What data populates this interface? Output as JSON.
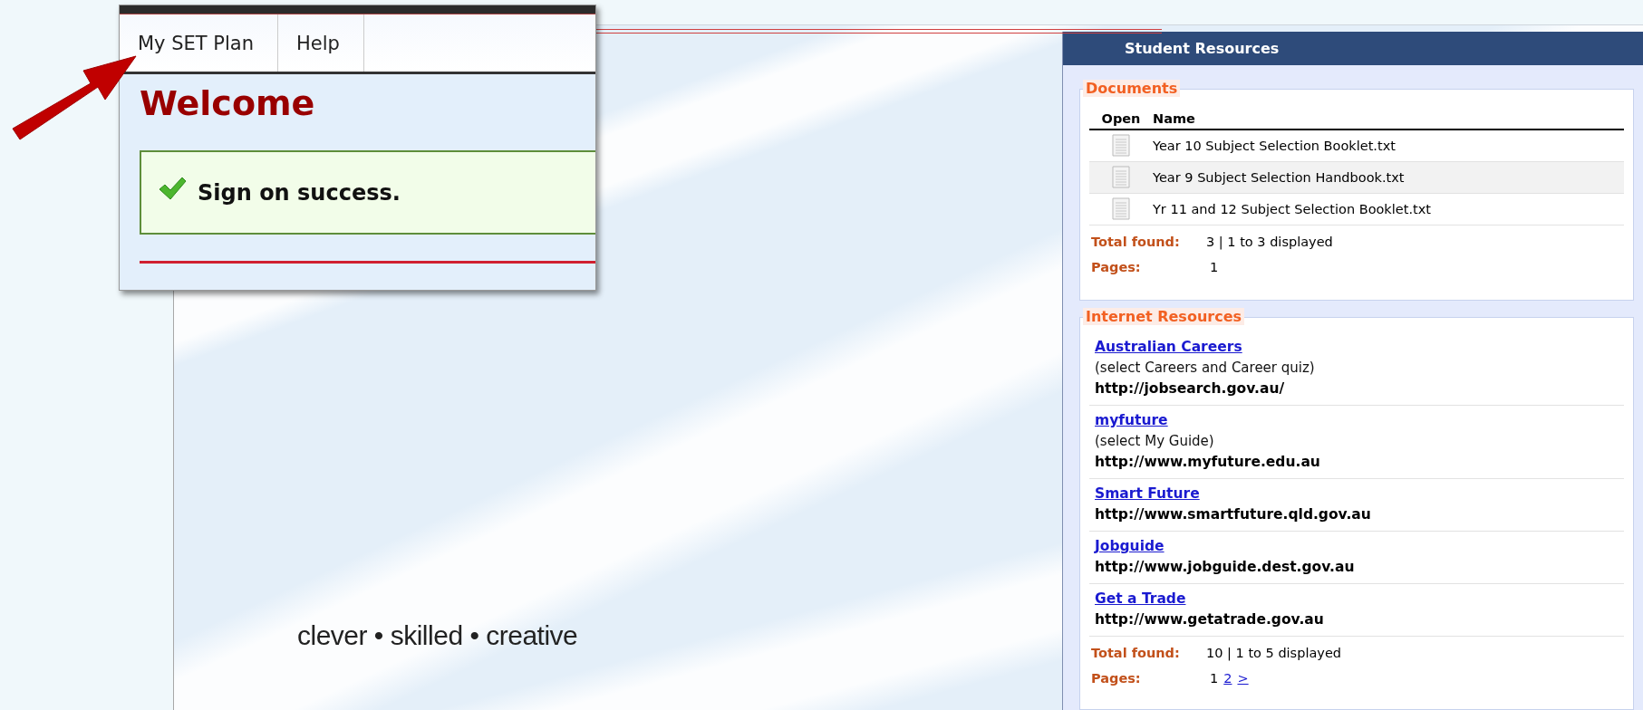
{
  "popup": {
    "menu": [
      {
        "label": "My SET Plan"
      },
      {
        "label": "Help"
      }
    ],
    "heading": "Welcome",
    "message": "Sign on success."
  },
  "tagline": "clever • skilled • creative",
  "panel": {
    "title": "Student Resources",
    "documents": {
      "title": "Documents",
      "columns": [
        "Open",
        "Name"
      ],
      "rows": [
        {
          "name": "Year 10 Subject Selection Booklet.txt"
        },
        {
          "name": "Year 9 Subject Selection Handbook.txt"
        },
        {
          "name": "Yr 11 and 12 Subject Selection Booklet.txt"
        }
      ],
      "total_label": "Total found:",
      "total": "3 | 1 to 3 displayed",
      "pages_label": "Pages:",
      "pages": [
        {
          "label": "1",
          "kind": "current"
        }
      ]
    },
    "internet": {
      "title": "Internet Resources",
      "items": [
        {
          "title": "Australian Careers",
          "note": "(select Careers and Career quiz)",
          "url": "http://jobsearch.gov.au/"
        },
        {
          "title": "myfuture",
          "note": "(select My Guide)",
          "url": "http://www.myfuture.edu.au"
        },
        {
          "title": "Smart Future",
          "url": "http://www.smartfuture.qld.gov.au"
        },
        {
          "title": "Jobguide",
          "url": "http://www.jobguide.dest.gov.au"
        },
        {
          "title": "Get a Trade",
          "url": "http://www.getatrade.gov.au"
        }
      ],
      "total_label": "Total found:",
      "total": "10 | 1 to 5 displayed",
      "pages_label": "Pages:",
      "pages": [
        {
          "label": "1",
          "kind": "current"
        },
        {
          "label": "2",
          "kind": "link"
        },
        {
          "label": ">",
          "kind": "link"
        }
      ]
    }
  }
}
